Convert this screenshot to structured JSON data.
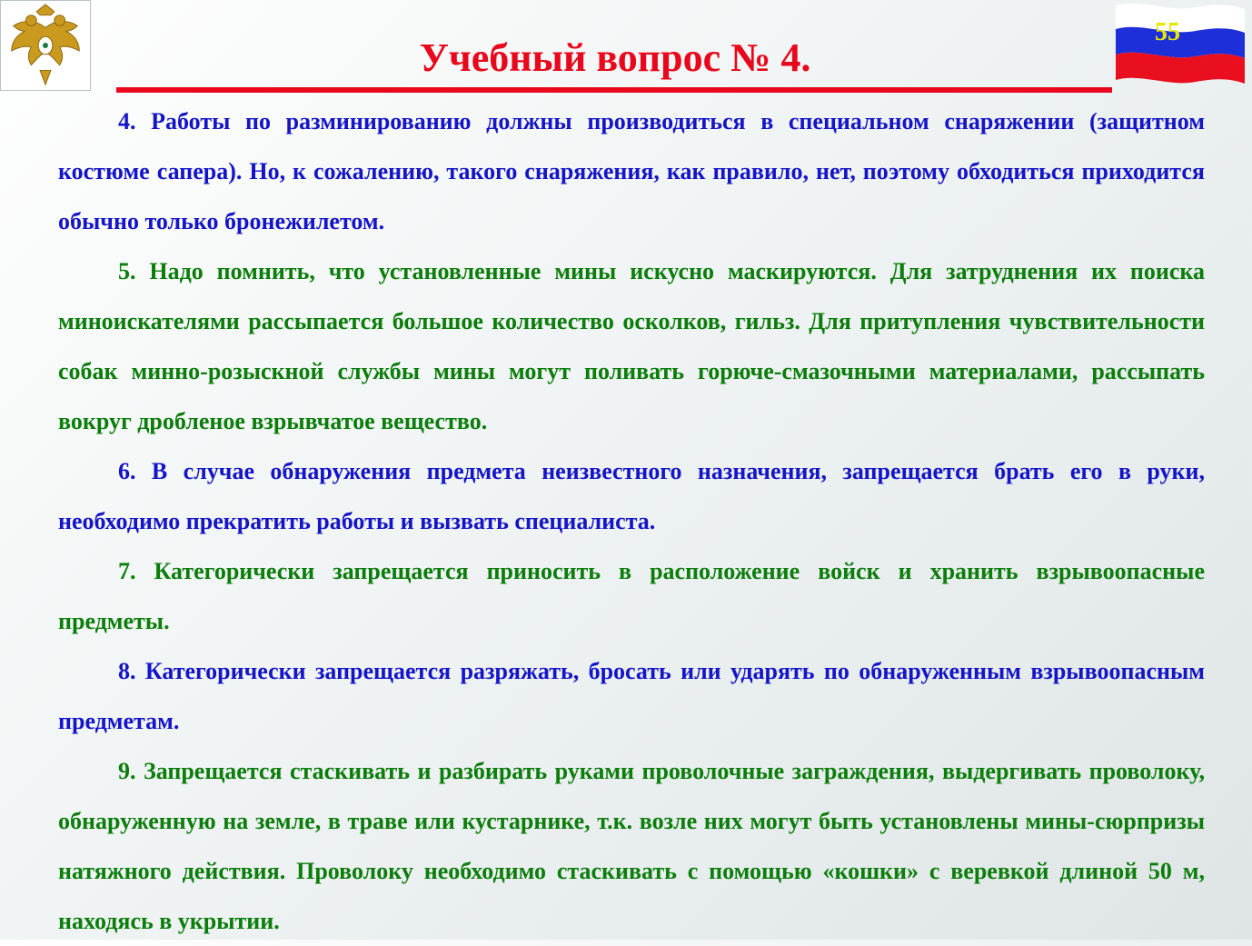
{
  "header": {
    "title": "Учебный вопрос № 4.",
    "slide_number": "55"
  },
  "colors": {
    "title": "#e8071b",
    "blue_text": "#1414c8",
    "green_text": "#0a7d0a",
    "slide_number": "#e6e600"
  },
  "icons": {
    "emblem": "double-headed-eagle-emblem-icon",
    "flag": "russian-flag-icon"
  },
  "paragraphs": [
    "4. Работы по разминированию должны производиться в специальном снаряжении (защитном костюме сапера). Но, к сожалению, такого снаряжения, как правило, нет, поэтому обходиться приходится обычно только бронежилетом.",
    "5. Надо помнить, что установленные мины искусно маскируются. Для затруднения их поиска миноискателями рассыпается большое количество осколков, гильз. Для притупления чувствительности собак минно-розыскной службы мины могут поливать горюче-смазочными материалами, рассыпать вокруг дробленое взрывчатое вещество.",
    "6. В случае обнаружения предмета неизвестного назначения, запрещается брать его в руки, необходимо прекратить работы и вызвать специалиста.",
    "7. Категорически запрещается приносить в расположение войск и хранить взрывоопасные предметы.",
    "8. Категорически запрещается разряжать, бросать или ударять по обнаруженным взрывоопасным предметам.",
    "9. Запрещается стаскивать и разбирать руками проволочные заграждения, выдергивать проволоку, обнаруженную на земле, в траве или кустарнике, т.к. возле них могут быть установлены мины-сюрпризы натяжного действия. Проволоку необходимо стаскивать с помощью «кошки» с веревкой длиной 50 м, находясь в укрытии."
  ]
}
